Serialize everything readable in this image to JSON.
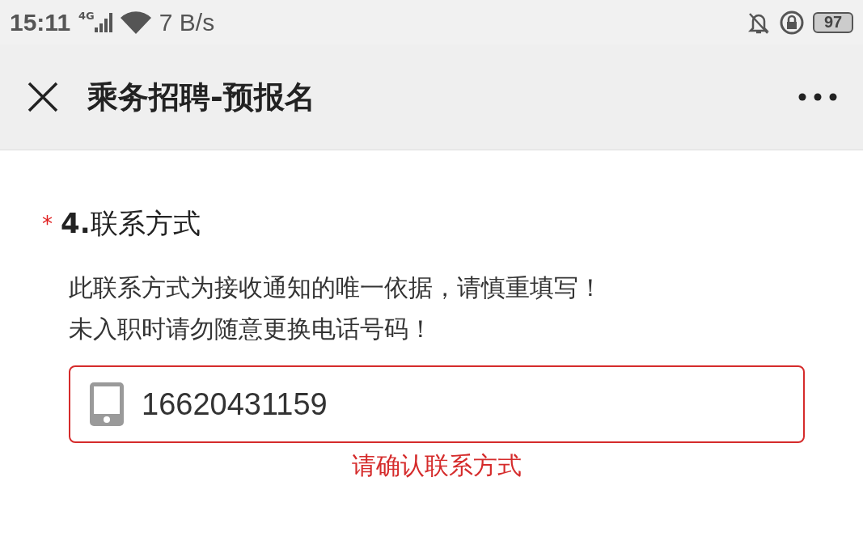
{
  "status_bar": {
    "time": "15:11",
    "network": "4G",
    "speed": "7 B/s",
    "battery": "97"
  },
  "header": {
    "title": "乘务招聘-预报名"
  },
  "question": {
    "required_marker": "*",
    "title": "**4.**联系方式",
    "description": [
      "此联系方式为接收通知的唯一依据，请慎重填写！",
      "未入职时请勿随意更换电话号码！"
    ],
    "field": {
      "value": "16620431159",
      "error": true
    },
    "error_message": "请确认联系方式"
  }
}
